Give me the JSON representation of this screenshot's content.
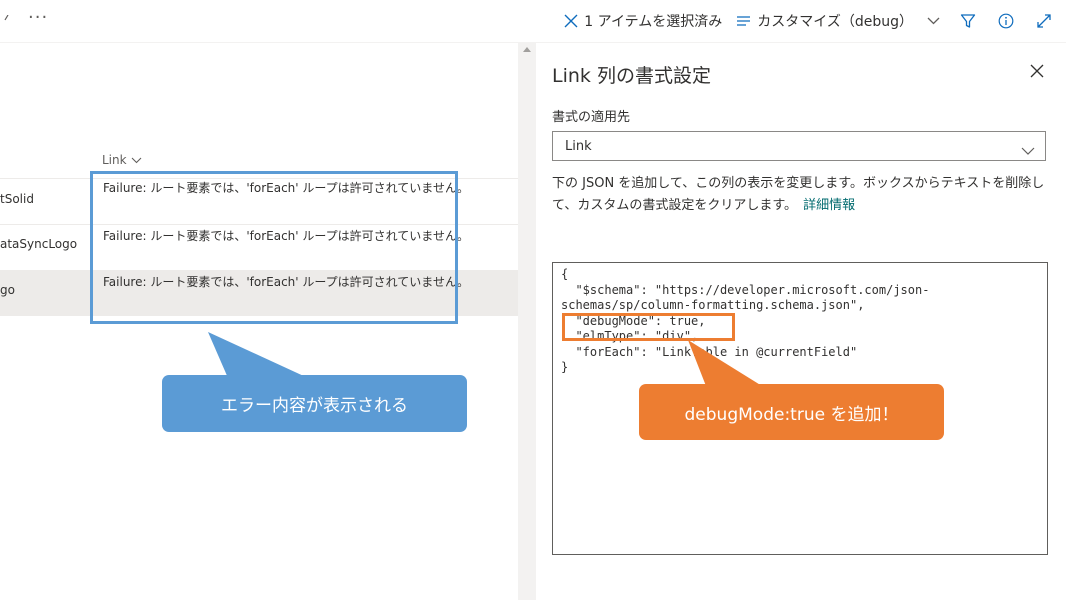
{
  "toolbar": {
    "selected_label": "1 アイテムを選択済み",
    "view_label": "カスタマイズ（debug）",
    "more_label": "···"
  },
  "list": {
    "column_header": "Link",
    "rows": [
      {
        "name": "tSolid",
        "value": "Failure: ルート要素では、'forEach' ループは許可されていません。"
      },
      {
        "name": "ataSyncLogo",
        "value": "Failure: ルート要素では、'forEach' ループは許可されていません。"
      },
      {
        "name": "go",
        "value": "Failure: ルート要素では、'forEach' ループは許可されていません。"
      }
    ]
  },
  "panel": {
    "title": "Link 列の書式設定",
    "apply_label": "書式の適用先",
    "apply_value": "Link",
    "description": "下の JSON を追加して、この列の表示を変更します。ボックスからテキストを削除して、カスタムの書式設定をクリアします。",
    "learn_more": "詳細情報",
    "code": "{\n  \"$schema\": \"https://developer.microsoft.com/json-\nschemas/sp/column-formatting.schema.json\",\n  \"debugMode\": true,\n  \"elmType\": \"div\",\n  \"forEach\": \"LinkTable in @currentField\"\n}"
  },
  "annotations": {
    "blue_callout": "エラー内容が表示される",
    "orange_callout": "debugMode:true を追加！"
  },
  "colors": {
    "blue": "#5b9bd5",
    "orange": "#ed7d31",
    "link": "#036c70"
  }
}
